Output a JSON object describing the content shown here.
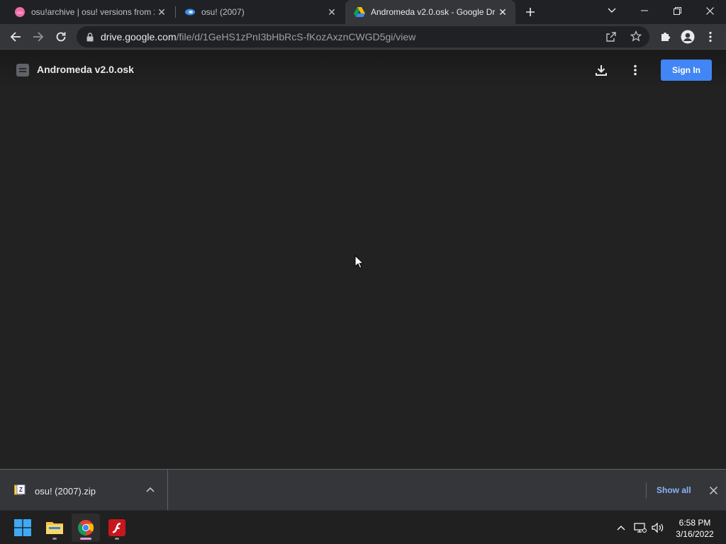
{
  "tabs": [
    {
      "title": "osu!archive | osu! versions from 2",
      "active": false
    },
    {
      "title": "osu! (2007)",
      "active": false
    },
    {
      "title": "Andromeda v2.0.osk - Google Dr",
      "active": true
    }
  ],
  "address_bar": {
    "host": "drive.google.com",
    "path": "/file/d/1GeHS1zPnI3bHbRcS-fKozAxznCWGD5gi/view"
  },
  "viewer": {
    "file_name": "Andromeda v2.0.osk",
    "sign_in_label": "Sign In"
  },
  "download_shelf": {
    "file_name": "osu! (2007).zip",
    "show_all_label": "Show all"
  },
  "taskbar": {
    "time": "6:58 PM",
    "date": "3/16/2022"
  },
  "colors": {
    "accent_blue": "#4285f4",
    "link_blue": "#8ab4f8",
    "viewer_bg": "#222222"
  }
}
